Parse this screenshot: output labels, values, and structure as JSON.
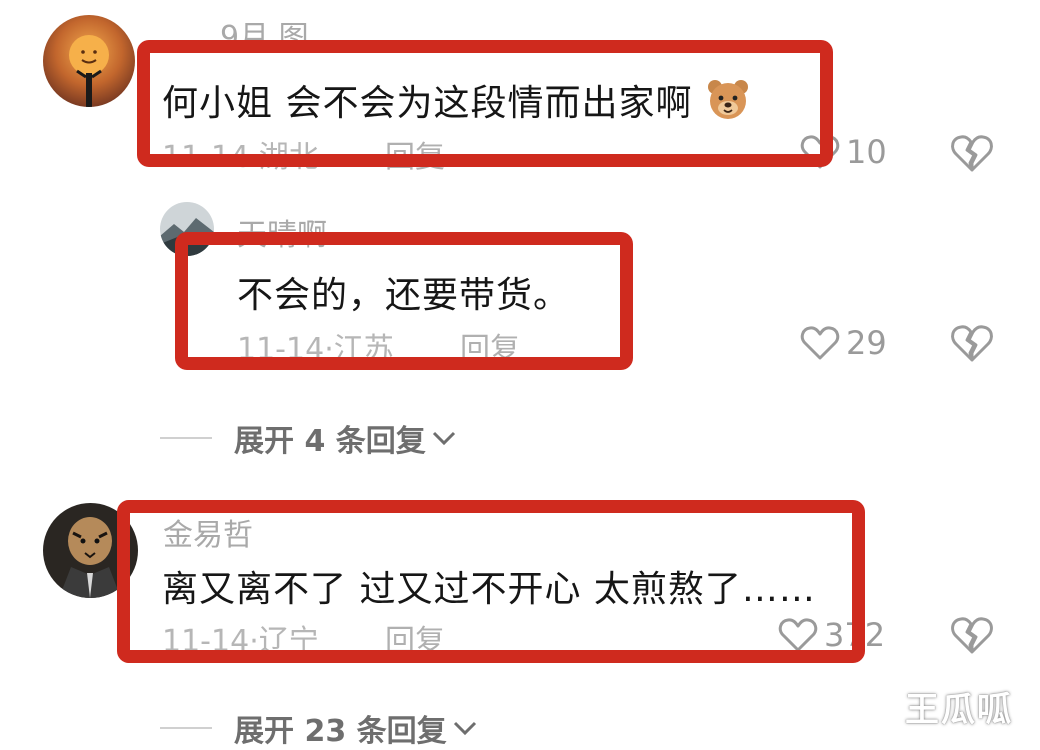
{
  "comments": [
    {
      "username": "9月 图",
      "content": "何小姐 会不会为这段情而出家啊",
      "emoji": "bear-face-emoji",
      "date": "11-14",
      "location": "湖北",
      "reply_label": "回复",
      "likes": "10"
    },
    {
      "username": "天晴啊",
      "content": "不会的，还要带货。",
      "date": "11-14",
      "location": "江苏",
      "reply_label": "回复",
      "likes": "29"
    },
    {
      "username": "金易哲",
      "content": "离又离不了  过又过不开心   太煎熬了……",
      "date": "11-14",
      "location": "辽宁",
      "reply_label": "回复",
      "likes": "372"
    }
  ],
  "expand_replies": [
    {
      "label": "展开 4 条回复"
    },
    {
      "label": "展开 23 条回复"
    }
  ],
  "meta_separator": "·",
  "watermark": "王瓜呱",
  "colors": {
    "highlight_box": "#cf2a1e",
    "text": "#161616",
    "muted": "#b6b6b6"
  },
  "icons": [
    "heart-outline-icon",
    "broken-heart-icon",
    "chevron-down-icon"
  ]
}
